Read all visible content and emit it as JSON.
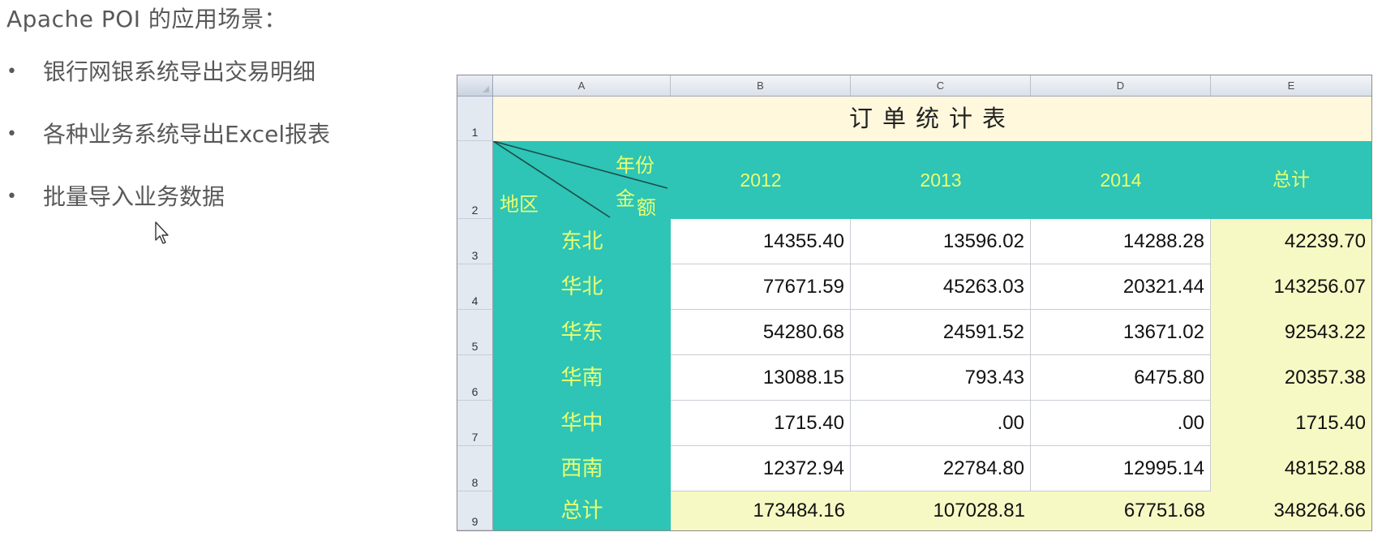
{
  "slide": {
    "title": "Apache POI 的应用场景：",
    "bullet_char": "•",
    "bullets": [
      "银行网银系统导出交易明细",
      "各种业务系统导出Excel报表",
      "批量导入业务数据"
    ]
  },
  "sheet": {
    "column_headers": [
      "A",
      "B",
      "C",
      "D",
      "E"
    ],
    "row_numbers": [
      "1",
      "2",
      "3",
      "4",
      "5",
      "6",
      "7",
      "8",
      "9"
    ],
    "table_title": "订单统计表",
    "header": {
      "year_label": "年份",
      "amount_label_1": "金",
      "amount_label_2": "额",
      "region_label": "地区",
      "years": [
        "2012",
        "2013",
        "2014"
      ],
      "total_label": "总计"
    },
    "rows": [
      {
        "region": "东北",
        "v2012": "14355.40",
        "v2013": "13596.02",
        "v2014": "14288.28",
        "total": "42239.70"
      },
      {
        "region": "华北",
        "v2012": "77671.59",
        "v2013": "45263.03",
        "v2014": "20321.44",
        "total": "143256.07"
      },
      {
        "region": "华东",
        "v2012": "54280.68",
        "v2013": "24591.52",
        "v2014": "13671.02",
        "total": "92543.22"
      },
      {
        "region": "华南",
        "v2012": "13088.15",
        "v2013": "793.43",
        "v2014": "6475.80",
        "total": "20357.38"
      },
      {
        "region": "华中",
        "v2012": "1715.40",
        "v2013": ".00",
        "v2014": ".00",
        "total": "1715.40"
      },
      {
        "region": "西南",
        "v2012": "12372.94",
        "v2013": "22784.80",
        "v2014": "12995.14",
        "total": "48152.88"
      }
    ],
    "totals_row": {
      "label": "总计",
      "v2012": "173484.16",
      "v2013": "107028.81",
      "v2014": "67751.68",
      "total": "348264.66"
    },
    "colors": {
      "teal": "#2ec4b6",
      "yellow_text": "#e8ff70",
      "cream": "#f7f9c4",
      "title_bg": "#fff8dc"
    }
  }
}
